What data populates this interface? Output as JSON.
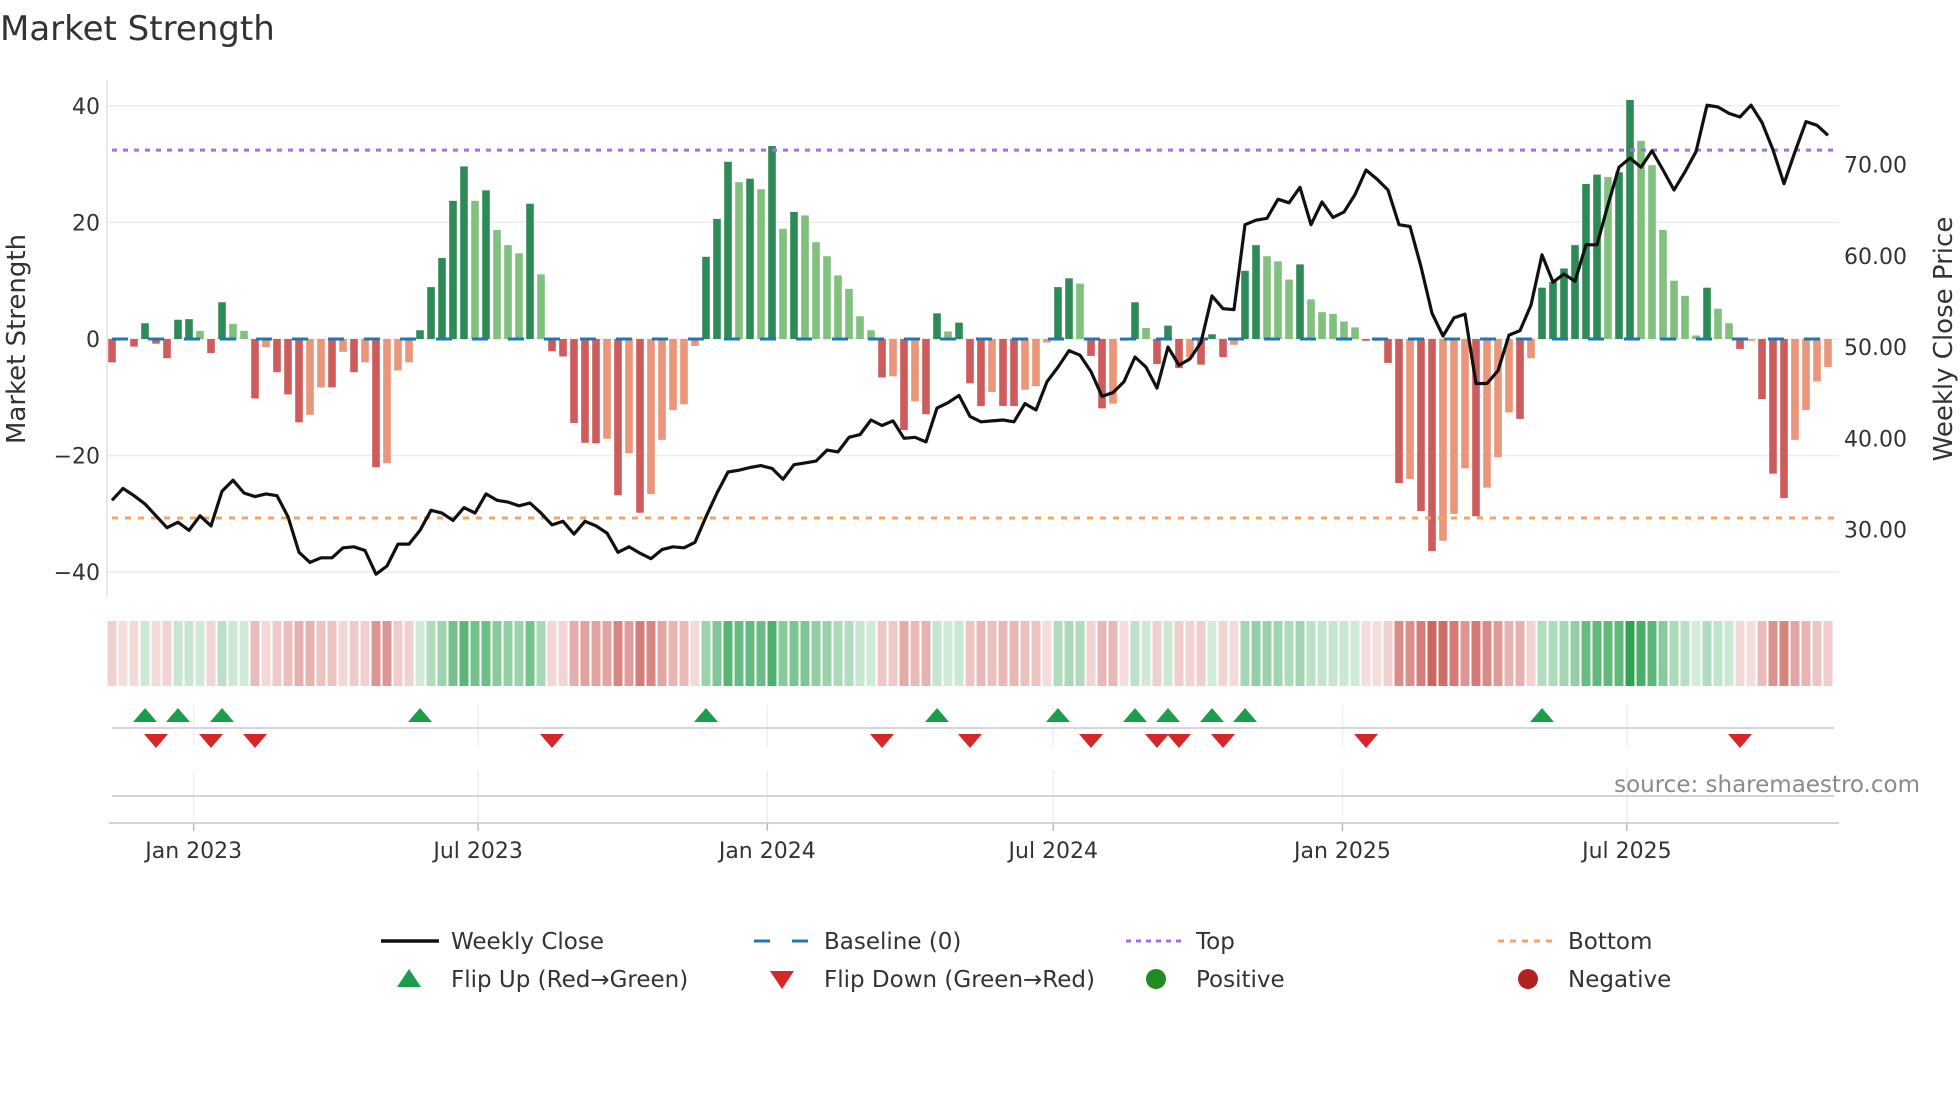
{
  "chart_data": {
    "type": "bar",
    "title": "Market Strength",
    "ylabel": "Market Strength",
    "ylabel_right": "Weekly Close Price",
    "xlabel": "",
    "ylim": [
      -45,
      44
    ],
    "ylim_right": [
      23,
      80
    ],
    "start_date": "2022-11-10",
    "frequency": "weekly",
    "yticks": [
      {
        "v": 40,
        "label": "40"
      },
      {
        "v": 20,
        "label": "20"
      },
      {
        "v": 0,
        "label": "0"
      },
      {
        "v": -20,
        "label": "−20"
      },
      {
        "v": -40,
        "label": "−40"
      }
    ],
    "yticks_right": [
      {
        "v": 70,
        "label": "70.00"
      },
      {
        "v": 60,
        "label": "60.00"
      },
      {
        "v": 50,
        "label": "50.00"
      },
      {
        "v": 40,
        "label": "40.00"
      },
      {
        "v": 30,
        "label": "30.00"
      }
    ],
    "xticks": [
      {
        "date": "2023-01-01",
        "label": "Jan 2023"
      },
      {
        "date": "2023-07-01",
        "label": "Jul 2023"
      },
      {
        "date": "2024-01-01",
        "label": "Jan 2024"
      },
      {
        "date": "2024-07-01",
        "label": "Jul 2024"
      },
      {
        "date": "2025-01-01",
        "label": "Jan 2025"
      },
      {
        "date": "2025-07-01",
        "label": "Jul 2025"
      }
    ],
    "top_threshold": 32.4,
    "bottom_threshold": -30.7,
    "baseline": 0,
    "grid": true,
    "legend_position": "bottom",
    "series": [
      {
        "name": "Market Strength",
        "type": "bar",
        "values": [
          -4.0,
          0,
          -1.3,
          2.7,
          -0.8,
          -3.3,
          3.3,
          3.4,
          1.4,
          -2.4,
          6.3,
          2.6,
          1.4,
          -10.2,
          -1.4,
          -5.7,
          -9.5,
          -14.3,
          -13,
          -8.3,
          -8.3,
          -2.2,
          -5.7,
          -4,
          -22,
          -21.3,
          -5.4,
          -4,
          1.5,
          8.9,
          13.9,
          23.7,
          29.6,
          23.7,
          25.5,
          18.7,
          16.1,
          14.7,
          23.2,
          11.1,
          -2.1,
          -3,
          -14.4,
          -17.8,
          -17.9,
          -17.1,
          -26.8,
          -19.6,
          -29.8,
          -26.6,
          -17.3,
          -12.2,
          -11.2,
          -1.2,
          14.1,
          20.6,
          30.4,
          26.9,
          27.5,
          25.7,
          33.1,
          18.9,
          21.8,
          21.2,
          16.6,
          14.2,
          10.9,
          8.6,
          3.9,
          1.5,
          -6.6,
          -6.4,
          -15.6,
          -10.7,
          -12.9,
          4.4,
          1.3,
          2.8,
          -7.6,
          -11.5,
          -9.1,
          -11.5,
          -11.5,
          -8.7,
          -8.1,
          -0.6,
          8.9,
          10.4,
          9.5,
          -2.9,
          -11.9,
          -11.1,
          -0.3,
          6.3,
          1.9,
          -4.3,
          2.3,
          -5,
          -3.2,
          -4.4,
          0.8,
          -3.1,
          -1,
          11.7,
          16.1,
          14.2,
          13.3,
          10.2,
          12.8,
          6.8,
          4.6,
          4.3,
          3,
          2,
          -0.3,
          -0.3,
          -4.1,
          -24.7,
          -24,
          -29.5,
          -36.4,
          -34.6,
          -30,
          -22.2,
          -30.4,
          -25.5,
          -20.3,
          -12.6,
          -13.7,
          -3.3,
          8.8,
          9.8,
          12.1,
          16.1,
          26.6,
          28.2,
          27.8,
          28.6,
          41,
          34,
          29.8,
          18.7,
          10,
          7.4,
          0.6,
          8.8,
          5.2,
          2.7,
          -1.7,
          -0.3,
          -10.3,
          -23.1,
          -27.3,
          -17.3,
          -12.2,
          -7.3,
          -4.8
        ]
      },
      {
        "name": "Weekly Close",
        "type": "line",
        "axis": "right",
        "values": [
          33.2,
          34.5,
          33.7,
          32.8,
          31.5,
          30.2,
          30.8,
          29.9,
          31.5,
          30.4,
          34.2,
          35.4,
          34.0,
          33.6,
          33.9,
          33.7,
          31.4,
          27.5,
          26.4,
          26.9,
          26.9,
          28.0,
          28.1,
          27.7,
          25.1,
          26.0,
          28.4,
          28.4,
          29.9,
          32.1,
          31.8,
          31.0,
          32.4,
          31.8,
          33.9,
          33.2,
          33.0,
          32.6,
          32.9,
          31.8,
          30.5,
          30.9,
          29.5,
          30.9,
          30.4,
          29.6,
          27.5,
          28.1,
          27.4,
          26.8,
          27.8,
          28.1,
          28.0,
          28.6,
          31.4,
          34.0,
          36.3,
          36.5,
          36.8,
          37.0,
          36.7,
          35.5,
          37.1,
          37.3,
          37.5,
          38.7,
          38.5,
          40.1,
          40.4,
          42.0,
          41.4,
          41.9,
          40.0,
          40.1,
          39.6,
          43.3,
          43.9,
          44.7,
          42.4,
          41.8,
          41.9,
          42.0,
          41.8,
          43.8,
          43.1,
          46.2,
          47.8,
          49.6,
          49.1,
          47.3,
          44.6,
          45.0,
          46.2,
          48.9,
          47.8,
          45.5,
          50.0,
          48.0,
          48.7,
          50.5,
          55.6,
          54.2,
          54.1,
          63.4,
          63.9,
          64.1,
          66.2,
          65.8,
          67.5,
          63.4,
          65.9,
          64.2,
          64.8,
          66.7,
          69.4,
          68.4,
          67.2,
          63.4,
          63.2,
          58.8,
          53.7,
          51.2,
          53.2,
          53.6,
          46.0,
          46.0,
          47.4,
          51.3,
          51.8,
          54.6,
          60.1,
          57.1,
          58.0,
          57.2,
          61.2,
          61.2,
          65.6,
          69.7,
          70.7,
          69.7,
          71.5,
          69.4,
          67.2,
          69.2,
          71.4,
          76.5,
          76.3,
          75.6,
          75.2,
          76.5,
          74.6,
          71.6,
          67.9,
          71.4,
          74.7,
          74.3,
          73.2
        ]
      }
    ],
    "flip_up_weeks": [
      3,
      6,
      10,
      28,
      54,
      75,
      86,
      93,
      96,
      100,
      103,
      130
    ],
    "flip_down_weeks": [
      4,
      9,
      13,
      40,
      70,
      78,
      89,
      95,
      97,
      101,
      114,
      148
    ],
    "colors": {
      "strong_positive": "#2e8b57",
      "weak_positive": "#81c07f",
      "strong_negative": "#cd5c5c",
      "weak_negative": "#e9967a",
      "line": "#111111",
      "baseline": "#1f77b4",
      "top": "#a56de2",
      "bottom": "#f4a460",
      "flip_up": "#1a9e4a",
      "flip_down": "#d62728",
      "heat_positive": "#31a354",
      "heat_negative": "#c85a55",
      "positive": "#228b22",
      "negative": "#b22222"
    },
    "legend": [
      {
        "label": "Weekly Close",
        "icon": "solid-line"
      },
      {
        "label": "Baseline (0)",
        "icon": "dashed-line"
      },
      {
        "label": "Top",
        "icon": "dotted-line"
      },
      {
        "label": "Bottom",
        "icon": "dashed-line"
      },
      {
        "label": "Flip Up (Red→Green)",
        "icon": "triangle-up"
      },
      {
        "label": "Flip Down (Green→Red)",
        "icon": "triangle-down"
      },
      {
        "label": "Positive",
        "icon": "circle"
      },
      {
        "label": "Negative",
        "icon": "circle"
      }
    ],
    "source": "source: sharemaestro.com"
  }
}
